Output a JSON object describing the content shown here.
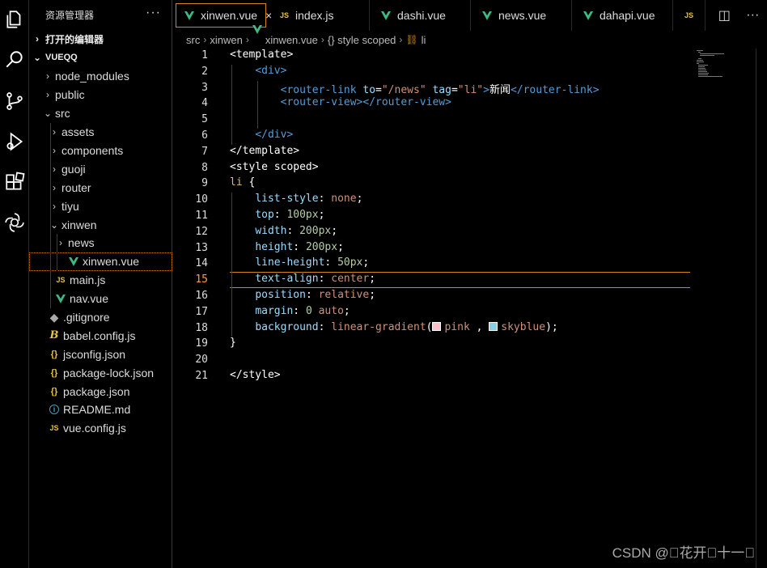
{
  "activity_icons": [
    "explorer-icon",
    "search-icon",
    "source-control-icon",
    "run-debug-icon",
    "extensions-icon",
    "openai-icon"
  ],
  "sidebar": {
    "title": "资源管理器",
    "more": "···",
    "open_editors": "打开的编辑器",
    "project": "VUEQQ",
    "tree": [
      {
        "label": "node_modules",
        "type": "folder",
        "depth": 1,
        "open": false
      },
      {
        "label": "public",
        "type": "folder",
        "depth": 1,
        "open": false
      },
      {
        "label": "src",
        "type": "folder",
        "depth": 1,
        "open": true
      },
      {
        "label": "assets",
        "type": "folder",
        "depth": 2,
        "open": false
      },
      {
        "label": "components",
        "type": "folder",
        "depth": 2,
        "open": false
      },
      {
        "label": "guoji",
        "type": "folder",
        "depth": 2,
        "open": false
      },
      {
        "label": "router",
        "type": "folder",
        "depth": 2,
        "open": false
      },
      {
        "label": "tiyu",
        "type": "folder",
        "depth": 2,
        "open": false
      },
      {
        "label": "xinwen",
        "type": "folder",
        "depth": 2,
        "open": true
      },
      {
        "label": "news",
        "type": "folder",
        "depth": 3,
        "open": false
      },
      {
        "label": "xinwen.vue",
        "type": "vue",
        "depth": 3,
        "selected": true
      },
      {
        "label": "main.js",
        "type": "js",
        "depth": 2
      },
      {
        "label": "nav.vue",
        "type": "vue",
        "depth": 2
      },
      {
        "label": ".gitignore",
        "type": "git",
        "depth": 1
      },
      {
        "label": "babel.config.js",
        "type": "babel",
        "depth": 1
      },
      {
        "label": "jsconfig.json",
        "type": "json",
        "depth": 1
      },
      {
        "label": "package-lock.json",
        "type": "json",
        "depth": 1
      },
      {
        "label": "package.json",
        "type": "json",
        "depth": 1
      },
      {
        "label": "README.md",
        "type": "info",
        "depth": 1
      },
      {
        "label": "vue.config.js",
        "type": "js",
        "depth": 1
      }
    ]
  },
  "tabs": [
    {
      "label": "xinwen.vue",
      "type": "vue",
      "active": true,
      "close": "×"
    },
    {
      "label": "index.js",
      "type": "js"
    },
    {
      "label": "dashi.vue",
      "type": "vue"
    },
    {
      "label": "news.vue",
      "type": "vue"
    },
    {
      "label": "dahapi.vue",
      "type": "vue"
    },
    {
      "label": "",
      "type": "js"
    }
  ],
  "breadcrumb": [
    "src",
    "xinwen",
    "xinwen.vue",
    "{} style scoped",
    "li"
  ],
  "code": {
    "current_line": 15,
    "lines": [
      [
        [
          "tk-w",
          "<template>"
        ]
      ],
      [
        [
          "tk-w",
          "    "
        ],
        [
          "tk-tag",
          "<div>"
        ]
      ],
      [
        [
          "tk-w",
          "        "
        ],
        [
          "tk-tag",
          "<router-link "
        ],
        [
          "tk-attr",
          "to"
        ],
        [
          "tk-w",
          "="
        ],
        [
          "tk-str",
          "\"/news\""
        ],
        [
          "tk-w",
          " "
        ],
        [
          "tk-attr",
          "tag"
        ],
        [
          "tk-w",
          "="
        ],
        [
          "tk-str",
          "\"li\""
        ],
        [
          "tk-tag",
          ">"
        ],
        [
          "tk-w",
          "新闻"
        ],
        [
          "tk-tag",
          "</router-link>"
        ]
      ],
      [
        [
          "tk-w",
          "        "
        ],
        [
          "tk-tag",
          "<router-view></router-view>"
        ]
      ],
      [],
      [
        [
          "tk-w",
          "    "
        ],
        [
          "tk-tag",
          "</div>"
        ]
      ],
      [
        [
          "tk-w",
          "</template>"
        ]
      ],
      [
        [
          "tk-w",
          "<style scoped>"
        ]
      ],
      [
        [
          "tk-sel",
          "li"
        ],
        [
          "tk-w",
          " {"
        ]
      ],
      [
        [
          "tk-w",
          "    "
        ],
        [
          "tk-prop",
          "list-style"
        ],
        [
          "tk-w",
          ": "
        ],
        [
          "tk-val",
          "none"
        ],
        [
          "tk-w",
          ";"
        ]
      ],
      [
        [
          "tk-w",
          "    "
        ],
        [
          "tk-prop",
          "top"
        ],
        [
          "tk-w",
          ": "
        ],
        [
          "tk-num",
          "100px"
        ],
        [
          "tk-w",
          ";"
        ]
      ],
      [
        [
          "tk-w",
          "    "
        ],
        [
          "tk-prop",
          "width"
        ],
        [
          "tk-w",
          ": "
        ],
        [
          "tk-num",
          "200px"
        ],
        [
          "tk-w",
          ";"
        ]
      ],
      [
        [
          "tk-w",
          "    "
        ],
        [
          "tk-prop",
          "height"
        ],
        [
          "tk-w",
          ": "
        ],
        [
          "tk-num",
          "200px"
        ],
        [
          "tk-w",
          ";"
        ]
      ],
      [
        [
          "tk-w",
          "    "
        ],
        [
          "tk-prop",
          "line-height"
        ],
        [
          "tk-w",
          ": "
        ],
        [
          "tk-num",
          "50px"
        ],
        [
          "tk-w",
          ";"
        ]
      ],
      [
        [
          "tk-w",
          "    "
        ],
        [
          "tk-prop",
          "text-align"
        ],
        [
          "tk-w",
          ": "
        ],
        [
          "tk-val",
          "center"
        ],
        [
          "tk-w",
          ";"
        ]
      ],
      [
        [
          "tk-w",
          "    "
        ],
        [
          "tk-prop",
          "position"
        ],
        [
          "tk-w",
          ": "
        ],
        [
          "tk-val",
          "relative"
        ],
        [
          "tk-w",
          ";"
        ]
      ],
      [
        [
          "tk-w",
          "    "
        ],
        [
          "tk-prop",
          "margin"
        ],
        [
          "tk-w",
          ": "
        ],
        [
          "tk-num",
          "0"
        ],
        [
          "tk-w",
          " "
        ],
        [
          "tk-val",
          "auto"
        ],
        [
          "tk-w",
          ";"
        ]
      ],
      [
        [
          "tk-w",
          "    "
        ],
        [
          "tk-prop",
          "background"
        ],
        [
          "tk-w",
          ": "
        ],
        [
          "tk-val",
          "linear-gradient"
        ],
        [
          "tk-w",
          "("
        ],
        [
          "swatch",
          "#ffc0cb"
        ],
        [
          "tk-val",
          "pink"
        ],
        [
          "tk-w",
          " , "
        ],
        [
          "swatch",
          "#87ceeb"
        ],
        [
          "tk-val",
          "skyblue"
        ],
        [
          "tk-w",
          ");"
        ]
      ],
      [
        [
          "tk-w",
          "}"
        ]
      ],
      [],
      [
        [
          "tk-w",
          "</style>"
        ]
      ]
    ]
  },
  "watermark": "CSDN @\u0000花开\u0000十一\u0000"
}
